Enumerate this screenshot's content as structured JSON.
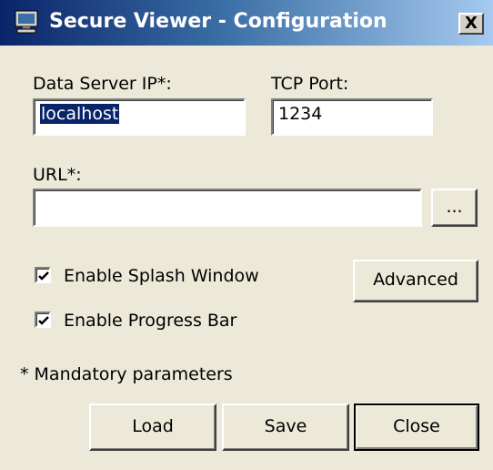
{
  "window": {
    "title": "Secure Viewer - Configuration",
    "close_glyph": "X",
    "title_gradient": [
      "#0a246a",
      "#a6caf0"
    ]
  },
  "form": {
    "server_ip_label": "Data Server IP*:",
    "server_ip_value": "localhost",
    "tcp_port_label": "TCP Port:",
    "tcp_port_value": "1234",
    "url_label": "URL*:",
    "url_value": "",
    "browse_label": "...",
    "splash_label": "Enable Splash Window",
    "splash_checked": true,
    "progress_label": "Enable Progress Bar",
    "progress_checked": true,
    "advanced_label": "Advanced",
    "mandatory_note": "* Mandatory parameters"
  },
  "buttons": {
    "load_label": "Load",
    "save_label": "Save",
    "close_label": "Close"
  },
  "icons": [
    "app-icon",
    "close-icon",
    "checkbox-check-icon"
  ]
}
